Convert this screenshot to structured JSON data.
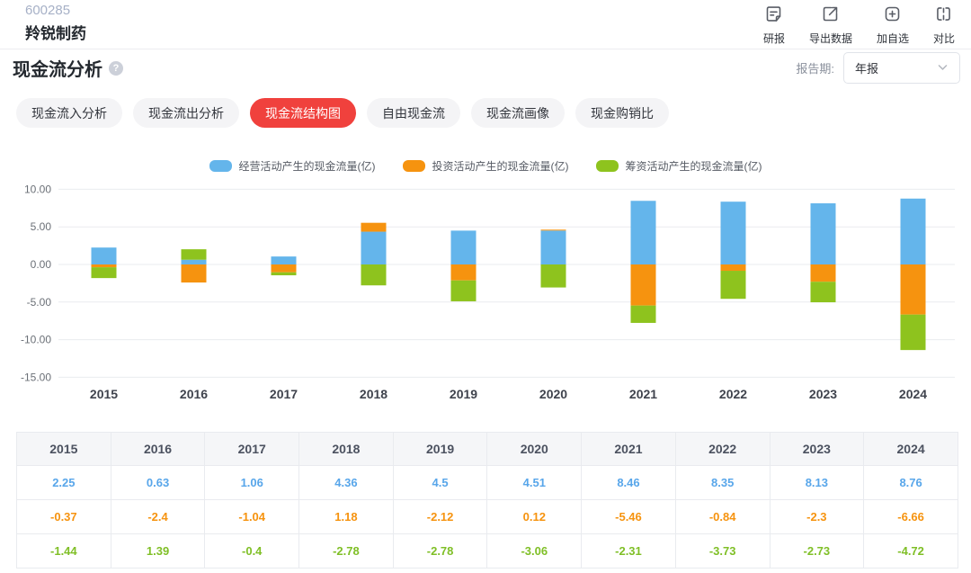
{
  "header": {
    "stock_code": "600285",
    "stock_name": "羚锐制药",
    "actions": [
      {
        "label": "研报",
        "icon": "report-icon"
      },
      {
        "label": "导出数据",
        "icon": "export-icon"
      },
      {
        "label": "加自选",
        "icon": "add-watchlist-icon"
      },
      {
        "label": "对比",
        "icon": "compare-icon"
      }
    ]
  },
  "title": {
    "text": "现金流分析",
    "help_glyph": "?"
  },
  "report_period": {
    "label": "报告期:",
    "selected": "年报"
  },
  "tabs": {
    "active_color": "#f0413d",
    "items": [
      {
        "label": "现金流入分析",
        "active": false
      },
      {
        "label": "现金流出分析",
        "active": false
      },
      {
        "label": "现金流结构图",
        "active": true
      },
      {
        "label": "自由现金流",
        "active": false
      },
      {
        "label": "现金流画像",
        "active": false
      },
      {
        "label": "现金购销比",
        "active": false
      }
    ]
  },
  "chart_data": {
    "type": "bar",
    "stacked": true,
    "grid": true,
    "legend_position": "top",
    "categories": [
      "2015",
      "2016",
      "2017",
      "2018",
      "2019",
      "2020",
      "2021",
      "2022",
      "2023",
      "2024"
    ],
    "series": [
      {
        "name": "经营活动产生的现金流量(亿)",
        "color": "#64b5eb",
        "values": [
          2.25,
          0.63,
          1.06,
          4.36,
          4.5,
          4.51,
          8.46,
          8.35,
          8.13,
          8.76
        ]
      },
      {
        "name": "投资活动产生的现金流量(亿)",
        "color": "#f6930f",
        "values": [
          -0.37,
          -2.4,
          -1.04,
          1.18,
          -2.12,
          0.12,
          -5.46,
          -0.84,
          -2.3,
          -6.66
        ]
      },
      {
        "name": "筹资活动产生的现金流量(亿)",
        "color": "#8ec31e",
        "values": [
          -1.44,
          1.39,
          -0.4,
          -2.78,
          -2.78,
          -3.06,
          -2.31,
          -3.73,
          -2.73,
          -4.72
        ]
      }
    ],
    "ylim": [
      -15,
      10
    ],
    "yticks": [
      10,
      5,
      0,
      -5,
      -10,
      -15
    ],
    "ytick_labels": [
      "10.00",
      "5.00",
      "0.00",
      "-5.00",
      "-10.00",
      "-15.00"
    ],
    "xlabel": "",
    "ylabel": ""
  },
  "table": {
    "years": [
      "2015",
      "2016",
      "2017",
      "2018",
      "2019",
      "2020",
      "2021",
      "2022",
      "2023",
      "2024"
    ],
    "rows": [
      {
        "series": "经营活动产生的现金流量(亿)",
        "color_class": "row-blue",
        "values": [
          "2.25",
          "0.63",
          "1.06",
          "4.36",
          "4.5",
          "4.51",
          "8.46",
          "8.35",
          "8.13",
          "8.76"
        ]
      },
      {
        "series": "投资活动产生的现金流量(亿)",
        "color_class": "row-orange",
        "values": [
          "-0.37",
          "-2.4",
          "-1.04",
          "1.18",
          "-2.12",
          "0.12",
          "-5.46",
          "-0.84",
          "-2.3",
          "-6.66"
        ]
      },
      {
        "series": "筹资活动产生的现金流量(亿)",
        "color_class": "row-green",
        "values": [
          "-1.44",
          "1.39",
          "-0.4",
          "-2.78",
          "-2.78",
          "-3.06",
          "-2.31",
          "-3.73",
          "-2.73",
          "-4.72"
        ]
      }
    ]
  }
}
